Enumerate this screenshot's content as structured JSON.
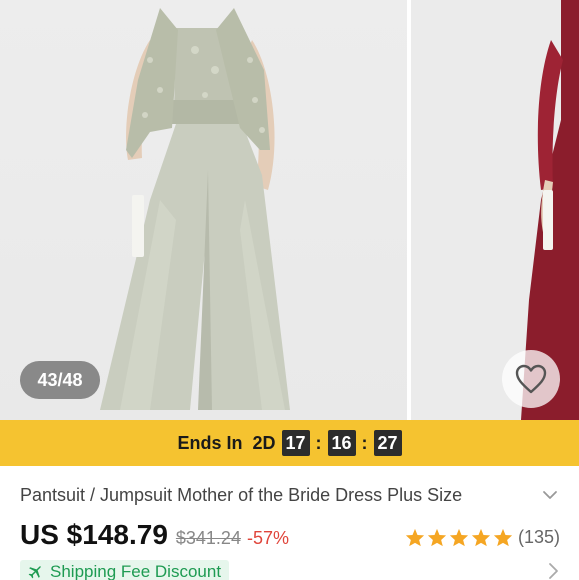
{
  "gallery": {
    "counter": "43/48",
    "main_image": "sage-green-lace-pantsuit-photo",
    "next_image": "burgundy-pantsuit-photo",
    "wishlist_icon": "heart-outline-icon"
  },
  "flash_sale": {
    "label": "Ends In",
    "days": "2D",
    "hours": "17",
    "minutes": "16",
    "seconds": "27",
    "separator": ":",
    "bar_color": "#f5c330"
  },
  "product": {
    "title": "Pantsuit / Jumpsuit Mother of the Bride Dress Plus Size",
    "price": "US $148.79",
    "original_price": "$341.24",
    "discount": "-57%",
    "rating_stars": 5,
    "review_count": "(135)",
    "discount_color": "#e0453b",
    "star_color": "#f5a623"
  },
  "shipping": {
    "label": "Shipping Fee Discount",
    "icon": "plane-icon",
    "text_color": "#1e9b52"
  }
}
